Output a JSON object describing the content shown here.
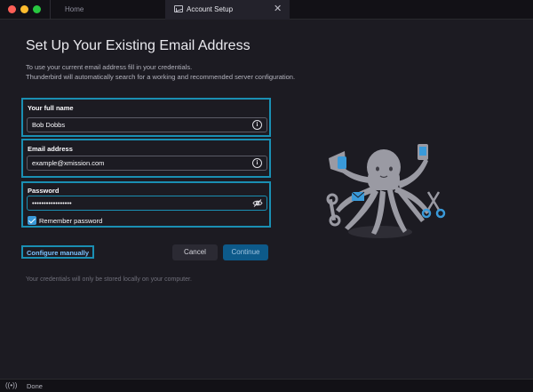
{
  "tabs": {
    "home_label": "Home",
    "active_label": "Account Setup",
    "close_glyph": "✕"
  },
  "header": {
    "title": "Set Up Your Existing Email Address",
    "subtitle_line1": "To use your current email address fill in your credentials.",
    "subtitle_line2": "Thunderbird will automatically search for a working and recommended server configuration."
  },
  "form": {
    "name": {
      "label": "Your full name",
      "value": "Bob Dobbs"
    },
    "email": {
      "label": "Email address",
      "value": "example@xmission.com"
    },
    "password": {
      "label": "Password",
      "value": "•••••••••••••••••"
    },
    "remember_label": "Remember password",
    "remember_checked": true
  },
  "actions": {
    "configure_label": "Configure manually",
    "cancel_label": "Cancel",
    "continue_label": "Continue"
  },
  "footnote": "Your credentials will only be stored locally on your computer.",
  "status": {
    "icon": "radio-waves-icon",
    "icon_glyph": "((•))",
    "text": "Done"
  },
  "colors": {
    "accent_outline": "#1a8fb3",
    "link": "#7ac2ff",
    "primary_button": "#0d5a8a",
    "illustration": "#9a9aa3",
    "illustration_accent": "#3a9ad9"
  }
}
